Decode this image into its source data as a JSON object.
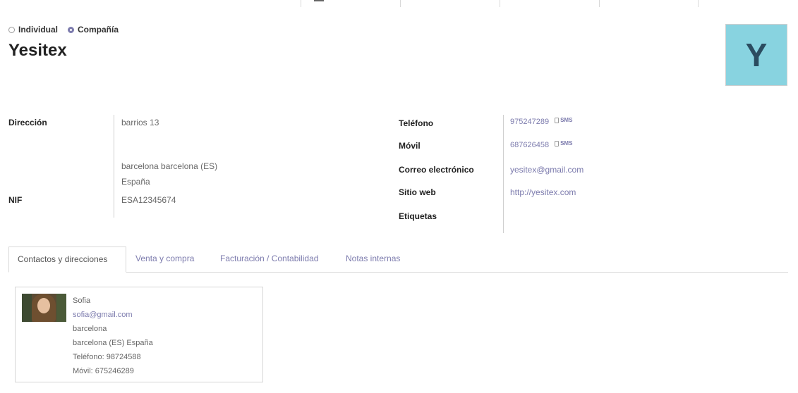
{
  "company_type": {
    "options": [
      {
        "label": "Individual",
        "checked": false
      },
      {
        "label": "Compañía",
        "checked": true
      }
    ]
  },
  "partner": {
    "name": "Yesitex",
    "avatar_letter": "Y",
    "avatar_color": "#88d3e0"
  },
  "address": {
    "label": "Dirección",
    "street": "barrios 13",
    "city_state": "barcelona  barcelona (ES)",
    "country": "España"
  },
  "vat": {
    "label": "NIF",
    "value": "ESA12345674"
  },
  "contact_info": {
    "phone_label": "Teléfono",
    "phone": "975247289",
    "mobile_label": "Móvil",
    "mobile": "687626458",
    "sms_label": "SMS",
    "email_label": "Correo electrónico",
    "email": "yesitex@gmail.com",
    "website_label": "Sitio web",
    "website": "http://yesitex.com",
    "tags_label": "Etiquetas"
  },
  "tabs": [
    {
      "label": "Contactos y direcciones",
      "active": true
    },
    {
      "label": "Venta y compra",
      "active": false
    },
    {
      "label": "Facturación / Contabilidad",
      "active": false
    },
    {
      "label": "Notas internas",
      "active": false
    }
  ],
  "contact_card": {
    "name": "Sofia",
    "email": "sofia@gmail.com",
    "city": "barcelona",
    "region": "barcelona (ES) España",
    "phone": "Teléfono: 98724588",
    "mobile": "Móvil: 675246289"
  },
  "accent_color": "#7c7bad"
}
